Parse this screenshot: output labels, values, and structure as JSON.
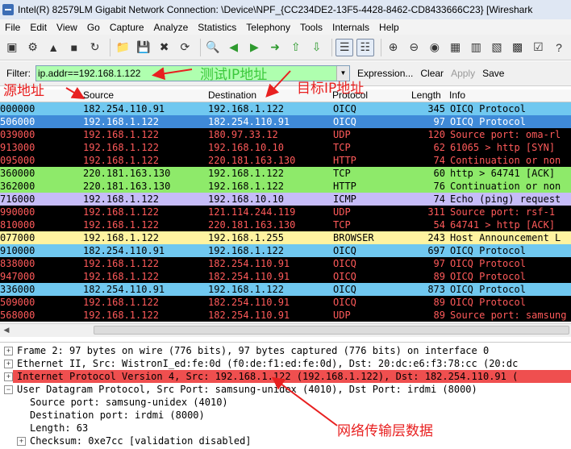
{
  "window": {
    "title": "Intel(R) 82579LM Gigabit Network Connection: \\Device\\NPF_{CC234DE2-13F5-4428-8462-CD8433666C23}  [Wireshark"
  },
  "menu": [
    "File",
    "Edit",
    "View",
    "Go",
    "Capture",
    "Analyze",
    "Statistics",
    "Telephony",
    "Tools",
    "Internals",
    "Help"
  ],
  "filter": {
    "label": "Filter:",
    "value": "ip.addr==192.168.1.122",
    "expression": "Expression...",
    "clear": "Clear",
    "apply": "Apply",
    "save": "Save"
  },
  "columns": {
    "source": "Source",
    "destination": "Destination",
    "protocol": "Protocol",
    "length": "Length",
    "info": "Info"
  },
  "packets": [
    {
      "no": "000000",
      "src": "182.254.110.91",
      "dst": "192.168.1.122",
      "proto": "OICQ",
      "len": "345",
      "info": "OICQ Protocol",
      "bg": "#70c8f0",
      "fg": "#000000"
    },
    {
      "no": "506000",
      "src": "192.168.1.122",
      "dst": "182.254.110.91",
      "proto": "OICQ",
      "len": "97",
      "info": "OICQ Protocol",
      "bg": "#3f8ad8",
      "fg": "#ffffff"
    },
    {
      "no": "039000",
      "src": "192.168.1.122",
      "dst": "180.97.33.12",
      "proto": "UDP",
      "len": "120",
      "info": "Source port: oma-rl",
      "bg": "#000000",
      "fg": "#ff5a5a"
    },
    {
      "no": "913000",
      "src": "192.168.1.122",
      "dst": "192.168.10.10",
      "proto": "TCP",
      "len": "62",
      "info": "61065 > http [SYN]",
      "bg": "#000000",
      "fg": "#ff5a5a"
    },
    {
      "no": "095000",
      "src": "192.168.1.122",
      "dst": "220.181.163.130",
      "proto": "HTTP",
      "len": "74",
      "info": "Continuation or non",
      "bg": "#000000",
      "fg": "#ff5a5a"
    },
    {
      "no": "360000",
      "src": "220.181.163.130",
      "dst": "192.168.1.122",
      "proto": "TCP",
      "len": "60",
      "info": "http > 64741 [ACK]",
      "bg": "#8eea6a",
      "fg": "#000000"
    },
    {
      "no": "362000",
      "src": "220.181.163.130",
      "dst": "192.168.1.122",
      "proto": "HTTP",
      "len": "76",
      "info": "Continuation or non",
      "bg": "#8eea6a",
      "fg": "#000000"
    },
    {
      "no": "716000",
      "src": "192.168.1.122",
      "dst": "192.168.10.10",
      "proto": "ICMP",
      "len": "74",
      "info": "Echo (ping) request",
      "bg": "#c6bcf8",
      "fg": "#000000"
    },
    {
      "no": "990000",
      "src": "192.168.1.122",
      "dst": "121.114.244.119",
      "proto": "UDP",
      "len": "311",
      "info": "Source port: rsf-1",
      "bg": "#000000",
      "fg": "#ff5a5a"
    },
    {
      "no": "810000",
      "src": "192.168.1.122",
      "dst": "220.181.163.130",
      "proto": "TCP",
      "len": "54",
      "info": "64741 > http [ACK]",
      "bg": "#000000",
      "fg": "#ff5a5a"
    },
    {
      "no": "077000",
      "src": "192.168.1.122",
      "dst": "192.168.1.255",
      "proto": "BROWSER",
      "len": "243",
      "info": "Host Announcement L",
      "bg": "#fff3a0",
      "fg": "#000000"
    },
    {
      "no": "910000",
      "src": "182.254.110.91",
      "dst": "192.168.1.122",
      "proto": "OICQ",
      "len": "697",
      "info": "OICQ Protocol",
      "bg": "#70c8f0",
      "fg": "#000000"
    },
    {
      "no": "838000",
      "src": "192.168.1.122",
      "dst": "182.254.110.91",
      "proto": "OICQ",
      "len": "97",
      "info": "OICQ Protocol",
      "bg": "#000000",
      "fg": "#ff5a5a"
    },
    {
      "no": "947000",
      "src": "192.168.1.122",
      "dst": "182.254.110.91",
      "proto": "OICQ",
      "len": "89",
      "info": "OICQ Protocol",
      "bg": "#000000",
      "fg": "#ff5a5a"
    },
    {
      "no": "336000",
      "src": "182.254.110.91",
      "dst": "192.168.1.122",
      "proto": "OICQ",
      "len": "873",
      "info": "OICQ Protocol",
      "bg": "#70c8f0",
      "fg": "#000000"
    },
    {
      "no": "509000",
      "src": "192.168.1.122",
      "dst": "182.254.110.91",
      "proto": "OICQ",
      "len": "89",
      "info": "OICQ Protocol",
      "bg": "#000000",
      "fg": "#ff5a5a"
    },
    {
      "no": "568000",
      "src": "192.168.1.122",
      "dst": "182.254.110.91",
      "proto": "UDP",
      "len": "89",
      "info": "Source port: samsung",
      "bg": "#000000",
      "fg": "#ff5a5a"
    }
  ],
  "details": [
    {
      "text": "Frame 2: 97 bytes on wire (776 bits), 97 bytes captured (776 bits) on interface 0",
      "indent": 0,
      "expander": "+",
      "bg": "",
      "fg": "#000000"
    },
    {
      "text": "Ethernet II, Src: WistronI_ed:fe:0d (f0:de:f1:ed:fe:0d), Dst: 20:dc:e6:f3:78:cc (20:dc",
      "indent": 0,
      "expander": "+",
      "bg": "",
      "fg": "#000000"
    },
    {
      "text": "Internet Protocol Version 4, Src: 192.168.1.122 (192.168.1.122), Dst: 182.254.110.91 (",
      "indent": 0,
      "expander": "+",
      "bg": "#ef4f4f",
      "fg": "#000000"
    },
    {
      "text": "User Datagram Protocol, Src Port: samsung-unidex (4010), Dst Port: irdmi (8000)",
      "indent": 0,
      "expander": "-",
      "bg": "",
      "fg": "#000000"
    },
    {
      "text": "Source port: samsung-unidex (4010)",
      "indent": 1,
      "expander": "",
      "bg": "",
      "fg": "#000000"
    },
    {
      "text": "Destination port: irdmi (8000)",
      "indent": 1,
      "expander": "",
      "bg": "",
      "fg": "#000000"
    },
    {
      "text": "Length: 63",
      "indent": 1,
      "expander": "",
      "bg": "",
      "fg": "#000000"
    },
    {
      "text": "Checksum: 0xe7cc [validation disabled]",
      "indent": 1,
      "expander": "+",
      "bg": "",
      "fg": "#000000"
    }
  ],
  "annotations": {
    "test_ip": "测试IP地址",
    "source_addr": "源地址",
    "dest_ip": "目标IP地址",
    "transport_data": "网络传输层数据"
  },
  "colors": {
    "annotation_green": "#3cc83c",
    "annotation_red": "#e82020",
    "filter_bg": "#afffaf"
  }
}
